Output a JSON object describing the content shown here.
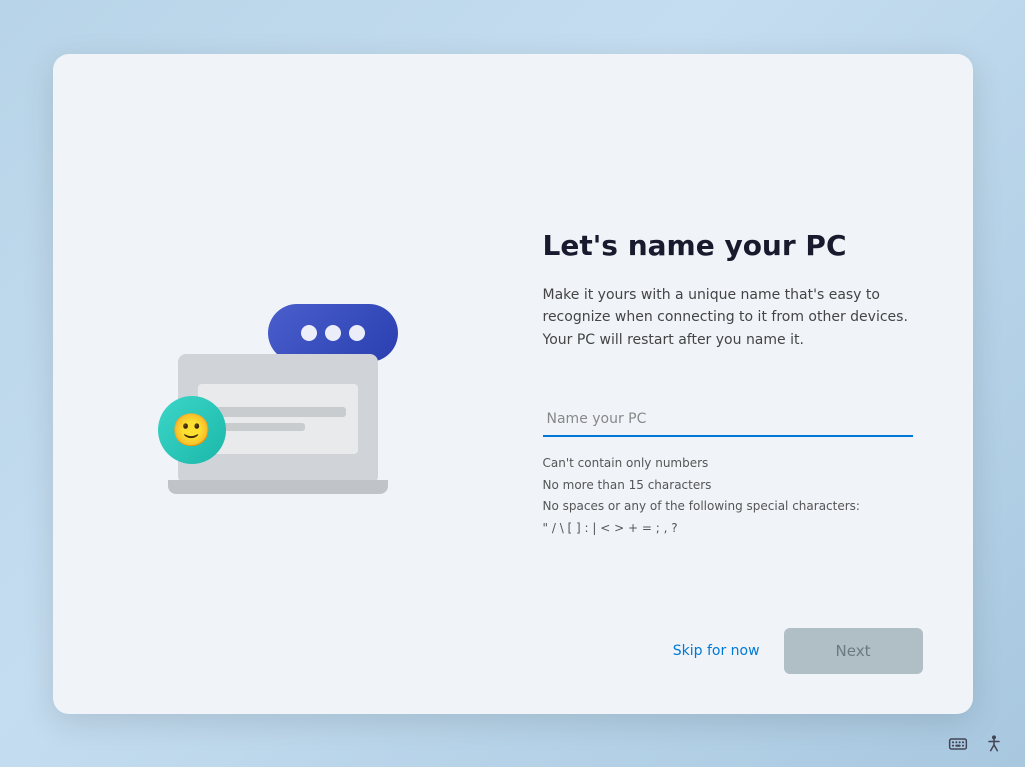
{
  "card": {
    "title": "Let's name your PC",
    "description": "Make it yours with a unique name that's easy to recognize when connecting to it from other devices. Your PC will restart after you name it.",
    "input": {
      "placeholder": "Name your PC"
    },
    "hints": {
      "line1": "Can't contain only numbers",
      "line2": "No more than 15 characters",
      "line3": "No spaces or any of the following special characters:",
      "line4": "\" / \\ [ ] : | < > + = ; , ?"
    },
    "footer": {
      "skip_label": "Skip for now",
      "next_label": "Next"
    }
  },
  "taskbar": {
    "keyboard_icon": "keyboard-icon",
    "accessibility_icon": "accessibility-icon"
  }
}
